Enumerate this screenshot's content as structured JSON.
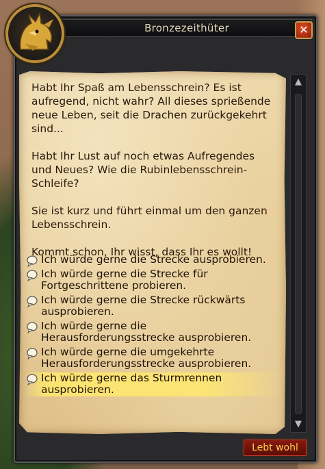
{
  "window": {
    "title": "Bronzezeithüter",
    "close_icon": "close-icon"
  },
  "greeting": {
    "paragraphs": [
      "Habt Ihr Spaß am Lebensschrein? Es ist aufregend, nicht wahr? All dieses sprießende neue Leben, seit die Drachen zurückgekehrt sind...",
      "Habt Ihr Lust auf noch etwas Aufregendes und Neues? Wie die Rubinlebensschrein-Schleife?",
      "Sie ist kurz und führt einmal um den ganzen Lebensschrein.",
      "Kommt schon, Ihr wisst, dass Ihr es wollt!"
    ]
  },
  "options": [
    {
      "text": "Ich würde gerne die Strecke ausprobieren.",
      "highlighted": false
    },
    {
      "text": "Ich würde gerne die Strecke für Fortgeschrittene probieren.",
      "highlighted": false
    },
    {
      "text": "Ich würde gerne die Strecke rückwärts ausprobieren.",
      "highlighted": false
    },
    {
      "text": "Ich würde gerne die Herausforderungsstrecke ausprobieren.",
      "highlighted": false
    },
    {
      "text": "Ich würde gerne die umgekehrte Herausforderungsstrecke ausprobieren.",
      "highlighted": false
    },
    {
      "text": "Ich würde gerne das Sturmrennen ausprobieren.",
      "highlighted": true
    }
  ],
  "footer": {
    "farewell_label": "Lebt wohl"
  },
  "colors": {
    "accent_gold": "#b88d3b",
    "button_red": "#8a1a10",
    "highlight": "#ffe86e"
  }
}
